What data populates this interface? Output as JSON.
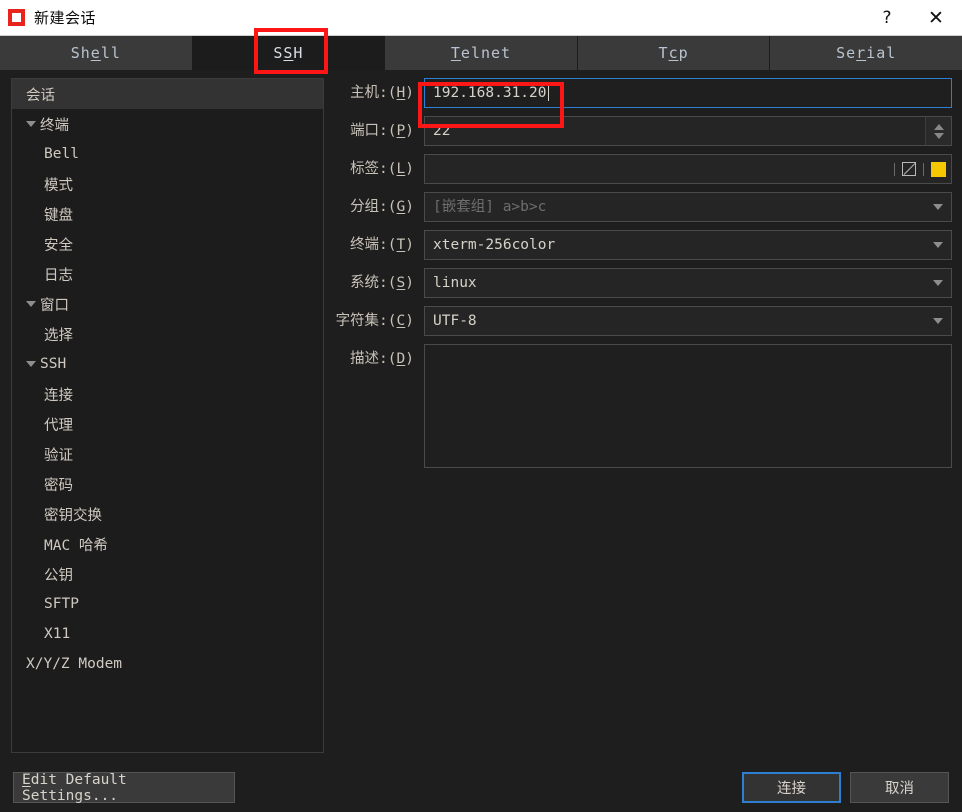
{
  "window": {
    "title": "新建会话",
    "icon": "app-logo-icon",
    "help_button": "?",
    "close_button": "✕"
  },
  "tabs": [
    {
      "label": "Shell",
      "accel_index": 2,
      "active": false
    },
    {
      "label": "SSH",
      "accel_index": 1,
      "active": true
    },
    {
      "label": "Telnet",
      "accel_index": 0,
      "active": false
    },
    {
      "label": "Tcp",
      "accel_index": 1,
      "active": false
    },
    {
      "label": "Serial",
      "accel_index": 2,
      "active": false
    }
  ],
  "sidebar": {
    "items": [
      {
        "label": "会话",
        "level": 0,
        "expandable": false,
        "selected": true
      },
      {
        "label": "终端",
        "level": 0,
        "expandable": true,
        "selected": false
      },
      {
        "label": "Bell",
        "level": 1,
        "expandable": false,
        "selected": false
      },
      {
        "label": "模式",
        "level": 1,
        "expandable": false,
        "selected": false
      },
      {
        "label": "键盘",
        "level": 1,
        "expandable": false,
        "selected": false
      },
      {
        "label": "安全",
        "level": 1,
        "expandable": false,
        "selected": false
      },
      {
        "label": "日志",
        "level": 1,
        "expandable": false,
        "selected": false
      },
      {
        "label": "窗口",
        "level": 0,
        "expandable": true,
        "selected": false
      },
      {
        "label": "选择",
        "level": 1,
        "expandable": false,
        "selected": false
      },
      {
        "label": "SSH",
        "level": 0,
        "expandable": true,
        "selected": false
      },
      {
        "label": "连接",
        "level": 1,
        "expandable": false,
        "selected": false
      },
      {
        "label": "代理",
        "level": 1,
        "expandable": false,
        "selected": false
      },
      {
        "label": "验证",
        "level": 1,
        "expandable": false,
        "selected": false
      },
      {
        "label": "密码",
        "level": 1,
        "expandable": false,
        "selected": false
      },
      {
        "label": "密钥交换",
        "level": 1,
        "expandable": false,
        "selected": false
      },
      {
        "label": "MAC 哈希",
        "level": 1,
        "expandable": false,
        "selected": false
      },
      {
        "label": "公钥",
        "level": 1,
        "expandable": false,
        "selected": false
      },
      {
        "label": "SFTP",
        "level": 1,
        "expandable": false,
        "selected": false
      },
      {
        "label": "X11",
        "level": 1,
        "expandable": false,
        "selected": false
      },
      {
        "label": "X/Y/Z Modem",
        "level": 0,
        "expandable": false,
        "selected": false
      }
    ]
  },
  "form": {
    "host": {
      "label": "主机:(H)",
      "value": "192.168.31.20",
      "focused": true
    },
    "port": {
      "label": "端口:(P)",
      "value": "22"
    },
    "label": {
      "label": "标签:(L)",
      "value": "",
      "swatch_color": "#f5c800",
      "edit_icon": "edit-square-icon"
    },
    "group": {
      "label": "分组:(G)",
      "value": "",
      "placeholder": "[嵌套组] a>b>c"
    },
    "terminal": {
      "label": "终端:(T)",
      "value": "xterm-256color"
    },
    "system": {
      "label": "系统:(S)",
      "value": "linux"
    },
    "charset": {
      "label": "字符集:(C)",
      "value": "UTF-8"
    },
    "desc": {
      "label": "描述:(D)",
      "value": ""
    }
  },
  "footer": {
    "edit_defaults": "Edit Default Settings...",
    "connect": "连接",
    "cancel": "取消"
  },
  "colors": {
    "accent_blue": "#2f7fd0",
    "annotation_red": "#fc1616",
    "swatch_yellow": "#f5c800",
    "background": "#1e1e1e"
  }
}
